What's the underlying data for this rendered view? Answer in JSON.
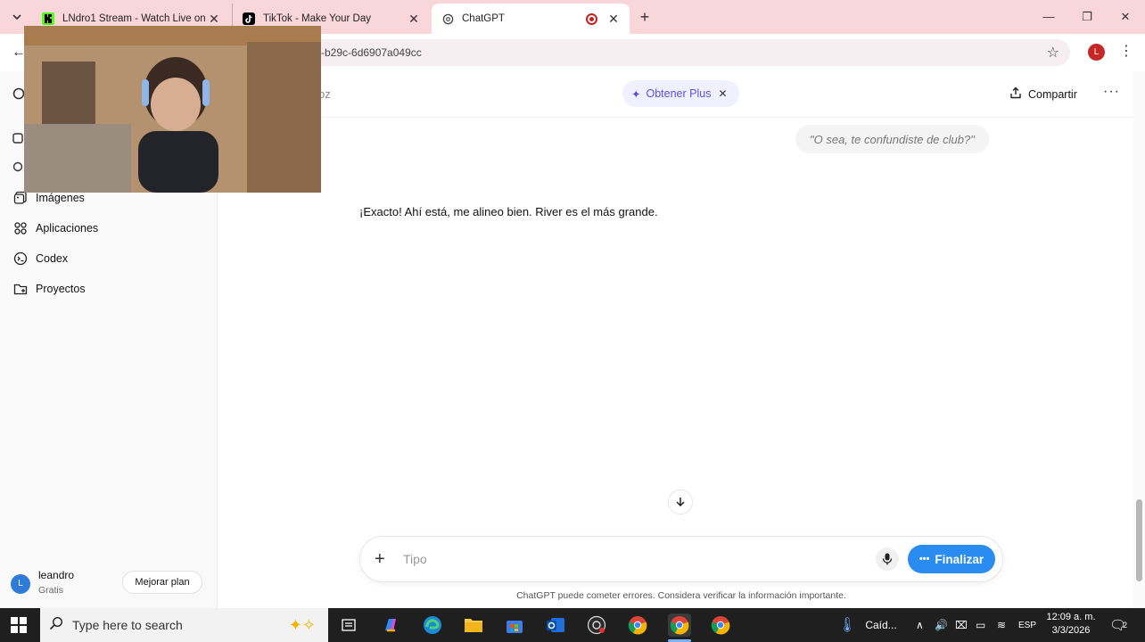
{
  "browser": {
    "tabs": [
      {
        "title": "LNdro1 Stream - Watch Live on",
        "favicon": "kick-icon",
        "color": "#53fc18"
      },
      {
        "title": "TikTok - Make Your Day",
        "favicon": "tiktok-icon"
      },
      {
        "title": "ChatGPT",
        "favicon": "openai-icon",
        "active": true
      }
    ],
    "url": "-b29c-6d6907a049cc",
    "profile_initial": "L"
  },
  "sidebar": {
    "items": [
      {
        "label": "Imágenes",
        "icon": "images-icon"
      },
      {
        "label": "Aplicaciones",
        "icon": "apps-grid-icon"
      },
      {
        "label": "Codex",
        "icon": "codex-icon"
      },
      {
        "label": "Proyectos",
        "icon": "folder-icon"
      }
    ],
    "user": {
      "initial": "L",
      "name": "leandro",
      "plan": "Gratis",
      "upgrade_label": "Mejorar plan"
    }
  },
  "header": {
    "model_peek": "oz",
    "plus_label": "Obtener Plus",
    "share_label": "Compartir"
  },
  "chat": {
    "user_message": "\"O sea, te confundiste de club?\"",
    "assistant_message": "¡Exacto! Ahí está, me alineo bien. River es el más grande."
  },
  "composer": {
    "placeholder": "Tipo",
    "finish_label": "Finalizar",
    "disclaimer": "ChatGPT puede cometer errores. Considera verificar la información importante."
  },
  "taskbar": {
    "search_placeholder": "Type here to search",
    "weather": "Caíd...",
    "language": "ESP",
    "time": "12:09 a. m.",
    "date": "3/3/2026",
    "notifications": "2"
  },
  "colors": {
    "accent_blue": "#2a8cf0",
    "plus_purple": "#5c4ee5",
    "tabstrip": "#f9d6d9"
  }
}
